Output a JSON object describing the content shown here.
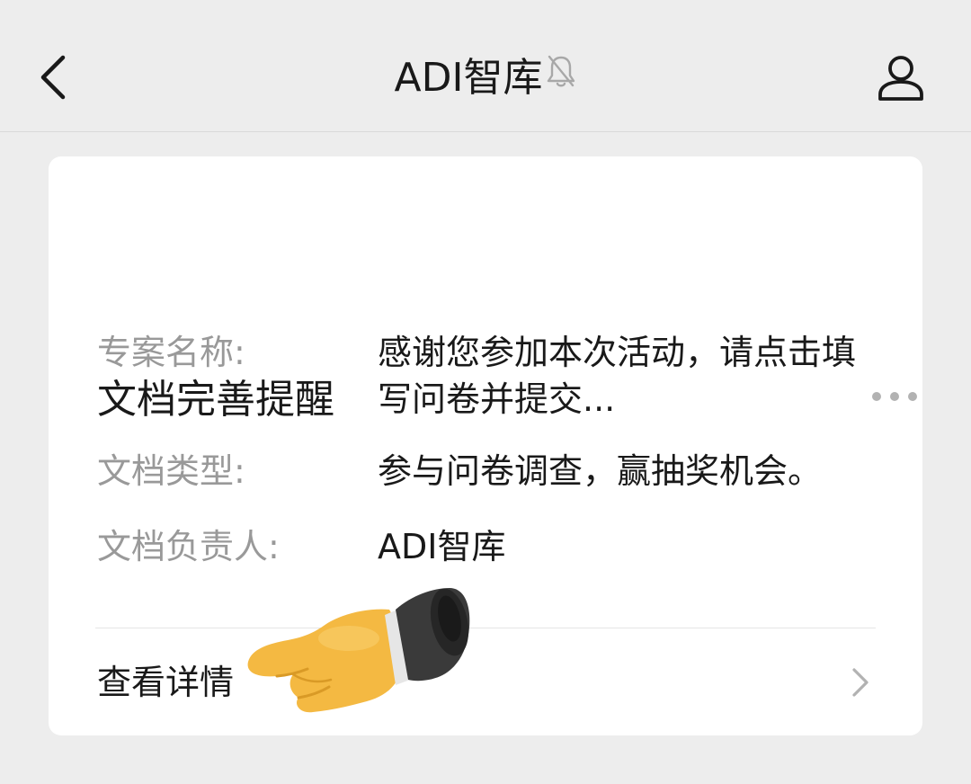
{
  "nav": {
    "title": "ADI智库",
    "back_icon": "chevron-left-icon",
    "mute_icon": "bell-off-icon",
    "profile_icon": "person-icon"
  },
  "card": {
    "title": "文档完善提醒",
    "more_icon": "ellipsis-icon",
    "rows": [
      {
        "label": "专案名称:",
        "value": "感谢您参加本次活动，请点击填写问卷并提交..."
      },
      {
        "label": "文档类型:",
        "value": "参与问卷调查，赢抽奖机会。"
      },
      {
        "label": "文档负责人:",
        "value": "ADI智库"
      }
    ],
    "detail_label": "查看详情",
    "detail_icon": "chevron-right-icon",
    "sticker": "pointing-hand-emoji"
  },
  "colors": {
    "background": "#ededed",
    "card": "#ffffff",
    "label_gray": "#999999",
    "text": "#191919",
    "hand": "#f4b942"
  }
}
